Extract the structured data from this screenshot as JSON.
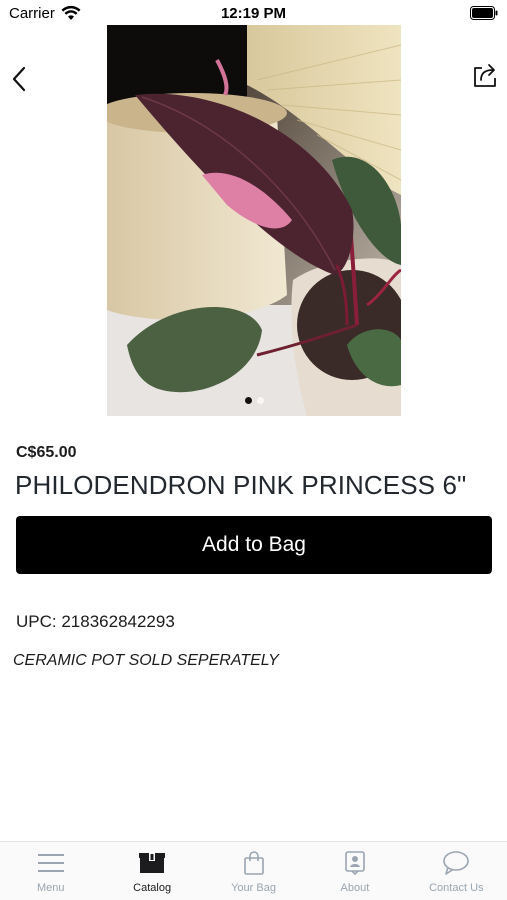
{
  "status_bar": {
    "carrier": "Carrier",
    "time": "12:19 PM"
  },
  "nav": {
    "back_icon": "chevron-left-icon",
    "share_icon": "share-icon"
  },
  "product": {
    "image_pages": 2,
    "image_current_page": 1,
    "price": "C$65.00",
    "title": "PHILODENDRON PINK PRINCESS 6\"",
    "add_to_bag_label": "Add to Bag",
    "upc": "UPC: 218362842293",
    "note": "CERAMIC POT SOLD SEPERATELY"
  },
  "tab_bar": {
    "items": [
      {
        "label": "Menu",
        "icon": "menu-icon",
        "active": false
      },
      {
        "label": "Catalog",
        "icon": "catalog-icon",
        "active": true
      },
      {
        "label": "Your Bag",
        "icon": "bag-icon",
        "active": false
      },
      {
        "label": "About",
        "icon": "about-icon",
        "active": false
      },
      {
        "label": "Contact Us",
        "icon": "chat-icon",
        "active": false
      }
    ]
  },
  "colors": {
    "button_bg": "#000000",
    "tab_inactive": "#9aa5b1",
    "tab_active": "#1c1c1e"
  }
}
